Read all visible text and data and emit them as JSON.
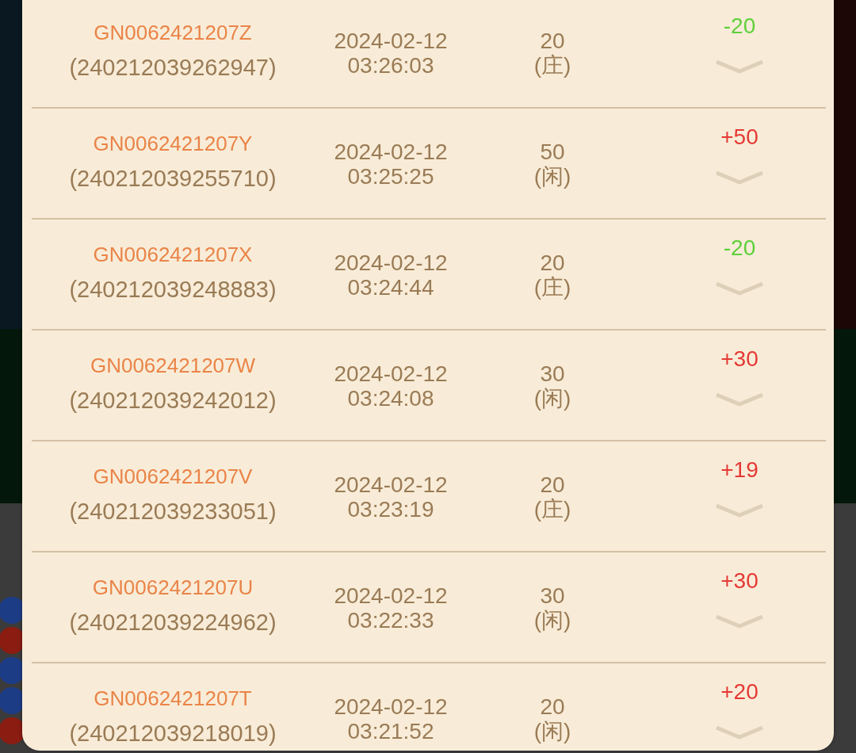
{
  "records": [
    {
      "order_no": "GN0062421207Z",
      "serial": "(240212039262947)",
      "date": "2024-02-12",
      "time": "03:26:03",
      "bet": "20",
      "side": "(庄)",
      "result": "-20",
      "color": "#5fcf3a",
      "expanded": false
    },
    {
      "order_no": "GN0062421207Y",
      "serial": "(240212039255710)",
      "date": "2024-02-12",
      "time": "03:25:25",
      "bet": "50",
      "side": "(闲)",
      "result": "+50",
      "color": "#e53935",
      "expanded": false
    },
    {
      "order_no": "GN0062421207X",
      "serial": "(240212039248883)",
      "date": "2024-02-12",
      "time": "03:24:44",
      "bet": "20",
      "side": "(庄)",
      "result": "-20",
      "color": "#5fcf3a",
      "expanded": false
    },
    {
      "order_no": "GN0062421207W",
      "serial": "(240212039242012)",
      "date": "2024-02-12",
      "time": "03:24:08",
      "bet": "30",
      "side": "(闲)",
      "result": "+30",
      "color": "#e53935",
      "expanded": false
    },
    {
      "order_no": "GN0062421207V",
      "serial": "(240212039233051)",
      "date": "2024-02-12",
      "time": "03:23:19",
      "bet": "20",
      "side": "(庄)",
      "result": "+19",
      "color": "#e53935",
      "expanded": false
    },
    {
      "order_no": "GN0062421207U",
      "serial": "(240212039224962)",
      "date": "2024-02-12",
      "time": "03:22:33",
      "bet": "30",
      "side": "(闲)",
      "result": "+30",
      "color": "#e53935",
      "expanded": false
    },
    {
      "order_no": "GN0062421207T",
      "serial": "(240212039218019)",
      "date": "2024-02-12",
      "time": "03:21:52",
      "bet": "20",
      "side": "(闲)",
      "result": "+20",
      "color": "#e53935",
      "expanded": false
    }
  ],
  "background_badges": [
    {
      "color": "#1d3c86"
    },
    {
      "color": "#8a1c12"
    },
    {
      "color": "#1d3c86"
    },
    {
      "color": "#1d3c86"
    },
    {
      "color": "#8a1c12"
    }
  ]
}
